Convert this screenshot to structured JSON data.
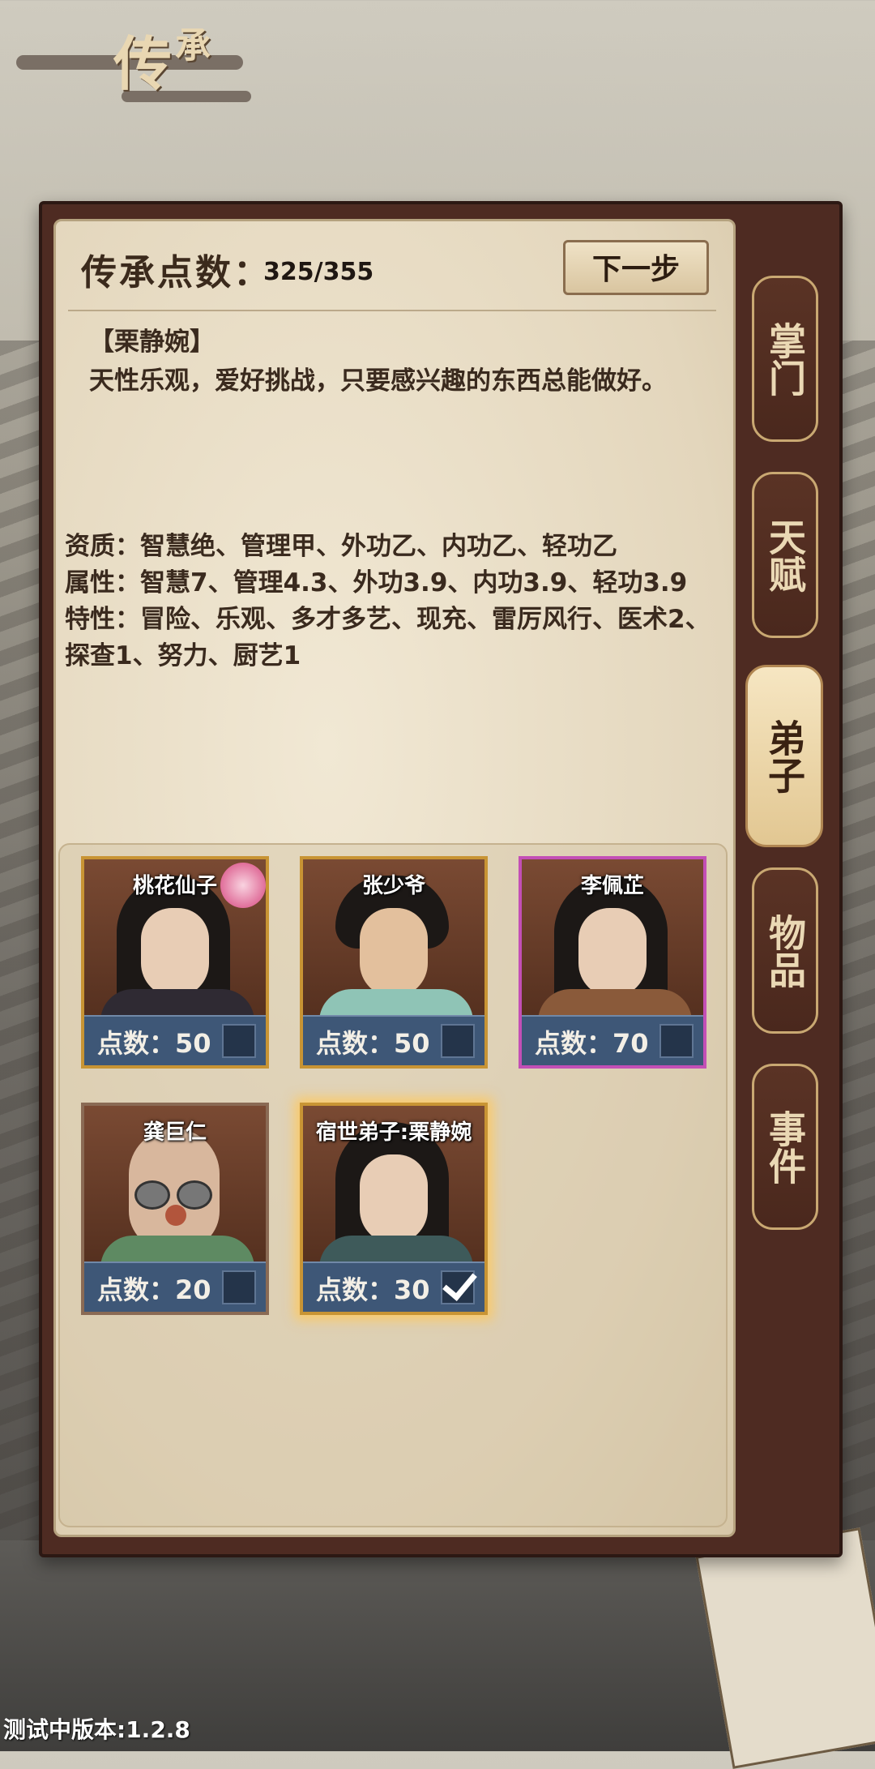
{
  "header": {
    "title_main": "传",
    "title_sub": "承"
  },
  "inheritance": {
    "points_label": "传承点数：",
    "points_value": "325/355",
    "next_button": "下一步"
  },
  "selected_disciple": {
    "name_line": "【栗静婉】",
    "description": "天性乐观，爱好挑战，只要感兴趣的东西总能做好。",
    "aptitude": "资质：智慧绝、管理甲、外功乙、内功乙、轻功乙",
    "attributes": "属性：智慧7、管理4.3、外功3.9、内功3.9、轻功3.9",
    "traits": "特性：冒险、乐观、多才多艺、现充、雷厉风行、医术2、探查1、努力、厨艺1"
  },
  "tabs": [
    {
      "label": "掌门"
    },
    {
      "label": "天赋"
    },
    {
      "label": "弟子"
    },
    {
      "label": "物品"
    },
    {
      "label": "事件"
    }
  ],
  "active_tab": "弟子",
  "disciples": [
    {
      "name": "桃花仙子",
      "score": "点数：50",
      "checked": false,
      "frame": "gold"
    },
    {
      "name": "张少爷",
      "score": "点数：50",
      "checked": false,
      "frame": "gold"
    },
    {
      "name": "李佩芷",
      "score": "点数：70",
      "checked": false,
      "frame": "purple"
    },
    {
      "name": "龚巨仁",
      "score": "点数：20",
      "checked": false,
      "frame": "plain"
    },
    {
      "name": "宿世弟子:栗静婉",
      "score": "点数：30",
      "checked": true,
      "frame": "gold"
    }
  ],
  "version": "测试中版本:1.2.8"
}
